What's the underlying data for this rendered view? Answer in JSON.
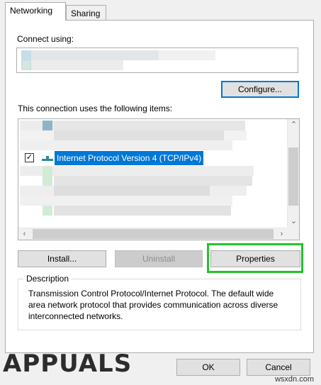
{
  "tabs": [
    {
      "label": "Networking",
      "active": true
    },
    {
      "label": "Sharing",
      "active": false
    }
  ],
  "connect_using": {
    "label": "Connect using:"
  },
  "buttons": {
    "configure": "Configure...",
    "install": "Install...",
    "uninstall": "Uninstall",
    "properties": "Properties",
    "ok": "OK",
    "cancel": "Cancel"
  },
  "items_section": {
    "label": "This connection uses the following items:",
    "selected_item": {
      "label": "Internet Protocol Version 4 (TCP/IPv4)",
      "checked": true
    }
  },
  "description": {
    "legend": "Description",
    "text": "Transmission Control Protocol/Internet Protocol. The default wide area network protocol that provides communication across diverse interconnected networks."
  },
  "branding": {
    "logo": "APPUALS",
    "watermark": "wsxdn.com"
  },
  "colors": {
    "accent": "#0078d7",
    "highlight_frame": "#22c32b",
    "selection": "#0078d7"
  },
  "icons": [
    "check-icon",
    "network-protocol-icon",
    "chevron-up-icon",
    "chevron-down-icon",
    "chevron-left-icon",
    "chevron-right-icon"
  ]
}
